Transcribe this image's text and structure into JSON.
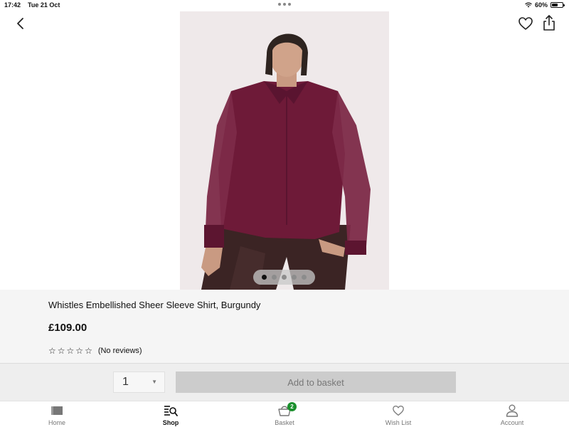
{
  "status_bar": {
    "time": "17:42",
    "date": "Tue 21 Oct",
    "battery": "60%",
    "battery_level": 0.6
  },
  "nav": {
    "back_icon": "chevron-left-icon",
    "wishlist_icon": "heart-icon",
    "share_icon": "share-icon"
  },
  "gallery": {
    "image_count": 5,
    "active_index": 0
  },
  "product": {
    "title": "Whistles Embellished Sheer Sleeve Shirt, Burgundy",
    "price": "£109.00",
    "rating_stars": 0,
    "reviews": "(No reviews)"
  },
  "basket": {
    "quantity": "1",
    "add_label": "Add to basket"
  },
  "tabs": [
    {
      "label": "Home",
      "icon": "home-icon",
      "active": false
    },
    {
      "label": "Shop",
      "icon": "shop-search-icon",
      "active": true
    },
    {
      "label": "Basket",
      "icon": "basket-icon",
      "active": false,
      "badge": "2"
    },
    {
      "label": "Wish List",
      "icon": "heart-icon",
      "active": false
    },
    {
      "label": "Account",
      "icon": "account-icon",
      "active": false
    }
  ],
  "colors": {
    "accent": "#1a8f2c",
    "shirt": "#6e1a38",
    "button_disabled": "#cccccc"
  }
}
